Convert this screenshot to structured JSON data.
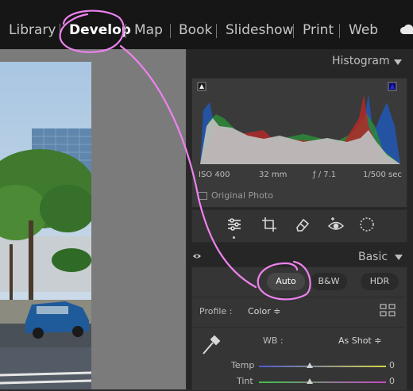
{
  "modules": [
    "Library",
    "Develop",
    "Map",
    "Book",
    "Slideshow",
    "Print",
    "Web"
  ],
  "active_module": "Develop",
  "histogram": {
    "title": "Histogram",
    "iso": "ISO 400",
    "focal": "32 mm",
    "aperture": "ƒ / 7.1",
    "shutter": "1/500 sec",
    "original_photo": "Original Photo"
  },
  "tools": [
    "sliders-icon",
    "crop-icon",
    "eraser-icon",
    "redeye-icon",
    "mask-icon"
  ],
  "basic": {
    "title": "Basic",
    "auto": "Auto",
    "bw": "B&W",
    "hdr": "HDR",
    "profile_label": "Profile :",
    "profile_value": "Color ≑",
    "wb_label": "WB :",
    "wb_value": "As Shot ≑",
    "temp_label": "Temp",
    "temp_value": "0",
    "tint_label": "Tint",
    "tint_value": "0"
  },
  "colors": {
    "annotation": "#ee82ee",
    "background": "#2b2b2b",
    "topbar": "#161616"
  }
}
